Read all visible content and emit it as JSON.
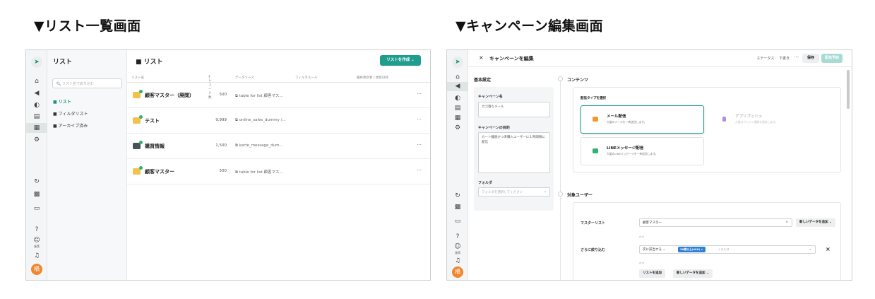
{
  "captions": {
    "list_screen": "▼リスト一覧画面",
    "campaign_screen": "▼キャンペーン編集画面"
  },
  "rail": {
    "bottom_label": "施策",
    "avatar": "橋"
  },
  "list_screen": {
    "nav_title": "リスト",
    "search_placeholder": "リスト名で絞り込む",
    "nav_items": [
      {
        "label": "リスト",
        "icon": "folder-icon",
        "active": true
      },
      {
        "label": "フィルタリスト",
        "icon": "folder-icon",
        "active": false
      },
      {
        "label": "アーカイブ済み",
        "icon": "folder-icon",
        "active": false
      }
    ],
    "main_title": "リスト",
    "create_button": "リストを作成",
    "columns": [
      "リスト名",
      "レコード数",
      "データソース",
      "フィルタルール",
      "最終更新者 / 更新日時"
    ],
    "rows": [
      {
        "name": "顧客マスター（廃閲）",
        "count": "500",
        "source": "table for list 顧客マス..."
      },
      {
        "name": "テスト",
        "count": "9,999",
        "source": "online_sales_dummy /..."
      },
      {
        "name": "購買情報",
        "count": "1,500",
        "source": "karte_message_dum..."
      },
      {
        "name": "顧客マスター",
        "count": "500",
        "source": "table for list 顧客マス..."
      }
    ]
  },
  "campaign_screen": {
    "title": "キャンペーンを編集",
    "status": "ステータス： 下書き",
    "save_button": "保存",
    "reserve_button": "配信予約",
    "basic_settings": "基本設定",
    "name_label": "キャンペーン名",
    "name_value": "カゴ落ちメール",
    "purpose_label": "キャンペーンの目的",
    "purpose_value": "カート離脱かつ未購入ユーザーに１時間毎に配信",
    "folder_label": "フォルダ",
    "folder_placeholder": "フォルダを選択してください",
    "contents_title": "コンテンツ",
    "delivery_type_label": "配信タイプを選択",
    "delivery_types": [
      {
        "title": "メール配信",
        "desc": "大量のメールを一斉送信します。",
        "selected": true,
        "disabled": false,
        "color": "#f29a2e"
      },
      {
        "title": "アプリプッシュ",
        "desc": "大量のプッシュ通知を配信します。",
        "selected": false,
        "disabled": true,
        "color": "#b48be0"
      },
      {
        "title": "LINEメッセージ配信",
        "desc": "大量のLINEメッセージを一斉送信します。",
        "selected": false,
        "disabled": false,
        "color": "#2fb36f"
      }
    ],
    "target_title": "対象ユーザー",
    "master_list_label": "マスターリスト",
    "master_list_value": "顧客マスター",
    "add_data_button": "新しいデータを追加",
    "and_text": "And",
    "narrow_label": "さらに絞り込む",
    "narrow_select": "次に該当する",
    "chip": "30歳以上(400)",
    "or_text": "+または",
    "add_list_button": "リストを追加"
  }
}
